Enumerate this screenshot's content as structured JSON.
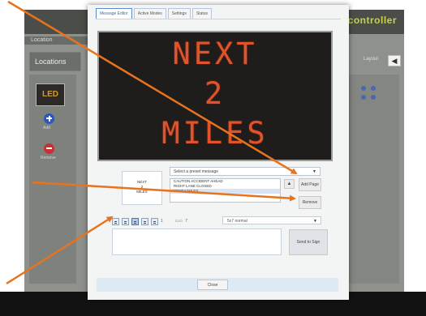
{
  "background_app": {
    "logo": "controller",
    "subheader": "Location",
    "locations_button": "Locations",
    "sign_type": "LED",
    "add_caption": "Add",
    "remove_caption": "Remove",
    "layout_label": "Layout"
  },
  "modal": {
    "tabs": [
      {
        "label": "Message Editor",
        "active": true
      },
      {
        "label": "Active Modes",
        "active": false
      },
      {
        "label": "Settings",
        "active": false
      },
      {
        "label": "Status",
        "active": false
      }
    ],
    "sign_message": [
      "NEXT",
      "2",
      "MILES"
    ],
    "sign_text_color": "#e0542b",
    "preview_lines": [
      "NEXT",
      "2",
      "MILES"
    ],
    "preset_select": "Select a preset message",
    "messages": [
      {
        "text": "CAUTION ACCIDENT AHEAD",
        "selected": false
      },
      {
        "text": "RIGHT LANE CLOSED",
        "selected": false
      },
      {
        "text": "NEXT 2 MILES",
        "selected": true
      }
    ],
    "add_page_label": "Add Page",
    "remove_label": "Remove",
    "toolbar": {
      "page_number": "1",
      "size": "7",
      "icons": [
        "align-left-icon",
        "align-center-icon",
        "align-right-icon",
        "justify-icon",
        "list-icon"
      ],
      "active_icon": 2
    },
    "font_select": "5x7 normal",
    "send_label": "Send to Sign",
    "close_label": "Close"
  },
  "annotation_color": "#e8731c"
}
